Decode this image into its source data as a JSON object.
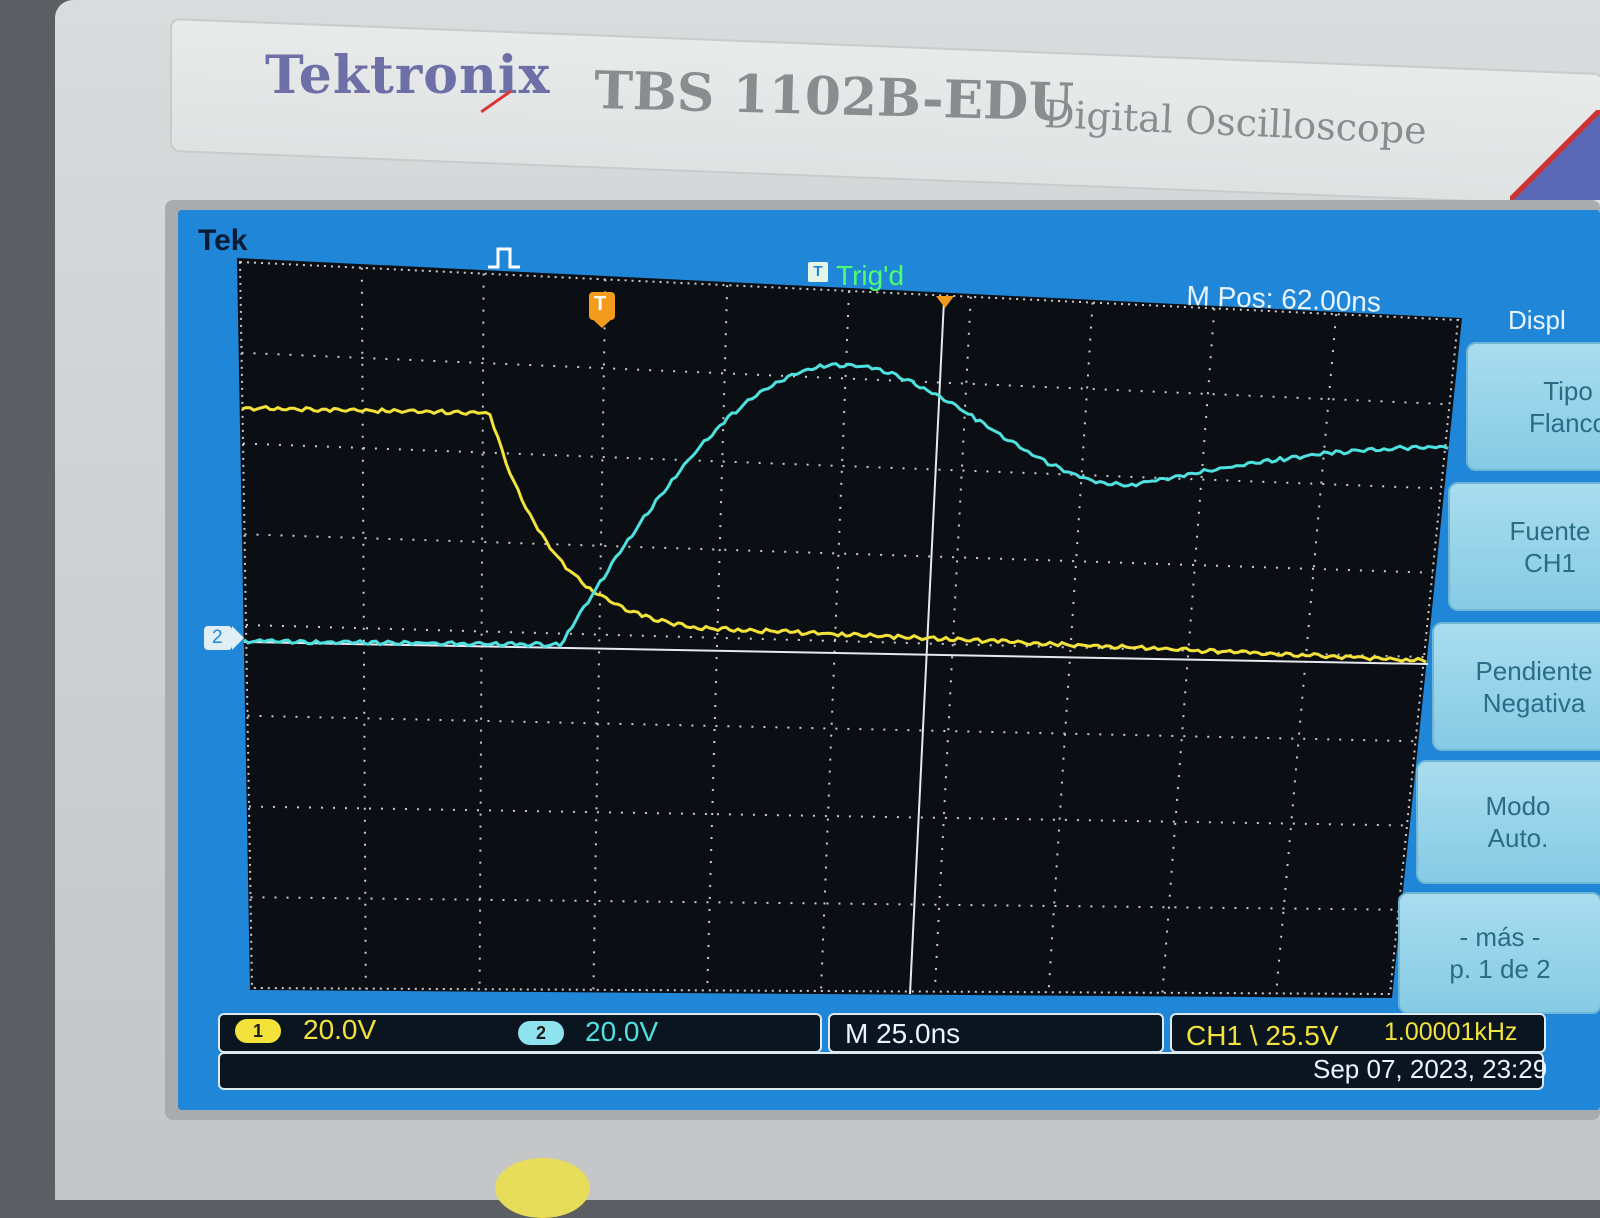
{
  "brand": {
    "maker": "Tektronix",
    "model": "TBS 1102B-EDU",
    "subtitle": "Digital Oscilloscope"
  },
  "screen": {
    "tek_label": "Tek",
    "trigger_status": "Trig'd",
    "trigger_icon": "T",
    "trigger_marker": "T",
    "horizontal_position": "M Pos: 62.00ns",
    "ch2_ground_marker": "2"
  },
  "menu": {
    "title": "Displ",
    "items": [
      {
        "line1": "Tipo",
        "line2": "Flanco"
      },
      {
        "line1": "Fuente",
        "line2": "CH1"
      },
      {
        "line1": "Pendiente",
        "line2": "Negativa"
      },
      {
        "line1": "Modo",
        "line2": "Auto."
      },
      {
        "line1": "- más -",
        "line2": "p. 1 de 2"
      }
    ]
  },
  "status": {
    "ch1_badge": "1",
    "ch1_scale": "20.0V",
    "ch2_badge": "2",
    "ch2_scale": "20.0V",
    "timebase": "M 25.0ns",
    "trigger": "CH1 \\ 25.5V",
    "frequency": "1.00001kHz",
    "datetime": "Sep 07, 2023, 23:29"
  },
  "colors": {
    "ch1": "#f2e23a",
    "ch2": "#4fe0e0",
    "screen_bg": "#0b0f14",
    "bezel_blue": "#1f86d8",
    "trigger_marker": "#f29b1d"
  },
  "icons": [
    "pulse-icon",
    "trigger-icon"
  ]
}
